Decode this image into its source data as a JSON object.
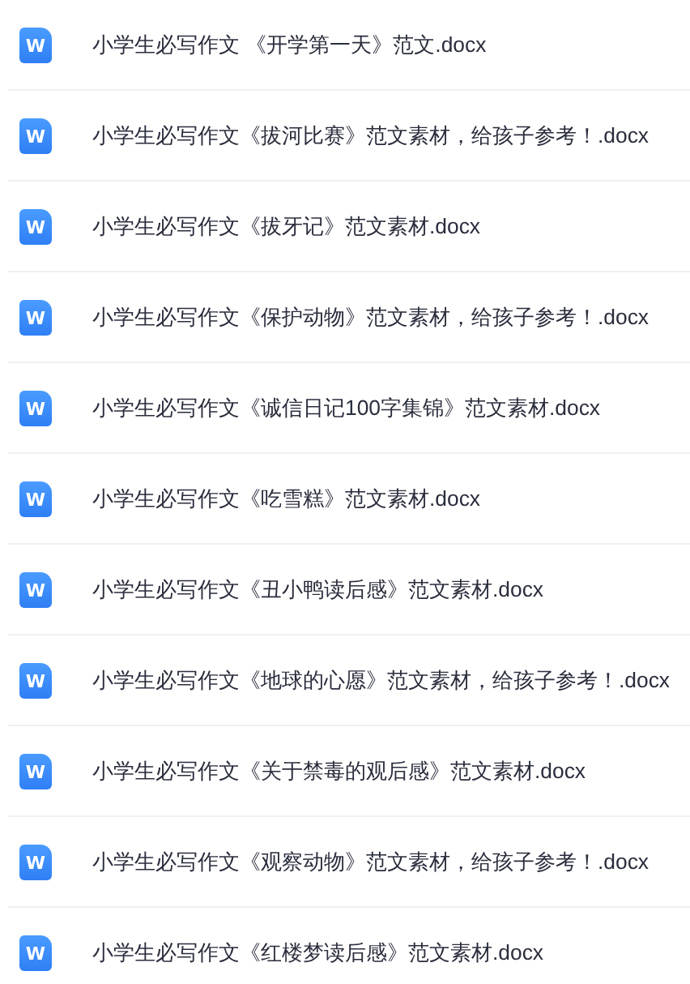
{
  "files": [
    {
      "icon": "W",
      "name": "小学生必写作文 《开学第一天》范文.docx"
    },
    {
      "icon": "W",
      "name": "小学生必写作文《拔河比赛》范文素材，给孩子参考！.docx"
    },
    {
      "icon": "W",
      "name": "小学生必写作文《拔牙记》范文素材.docx"
    },
    {
      "icon": "W",
      "name": "小学生必写作文《保护动物》范文素材，给孩子参考！.docx"
    },
    {
      "icon": "W",
      "name": "小学生必写作文《诚信日记100字集锦》范文素材.docx"
    },
    {
      "icon": "W",
      "name": "小学生必写作文《吃雪糕》范文素材.docx"
    },
    {
      "icon": "W",
      "name": "小学生必写作文《丑小鸭读后感》范文素材.docx"
    },
    {
      "icon": "W",
      "name": "小学生必写作文《地球的心愿》范文素材，给孩子参考！.docx"
    },
    {
      "icon": "W",
      "name": "小学生必写作文《关于禁毒的观后感》范文素材.docx"
    },
    {
      "icon": "W",
      "name": "小学生必写作文《观察动物》范文素材，给孩子参考！.docx"
    },
    {
      "icon": "W",
      "name": "小学生必写作文《红楼梦读后感》范文素材.docx"
    }
  ]
}
